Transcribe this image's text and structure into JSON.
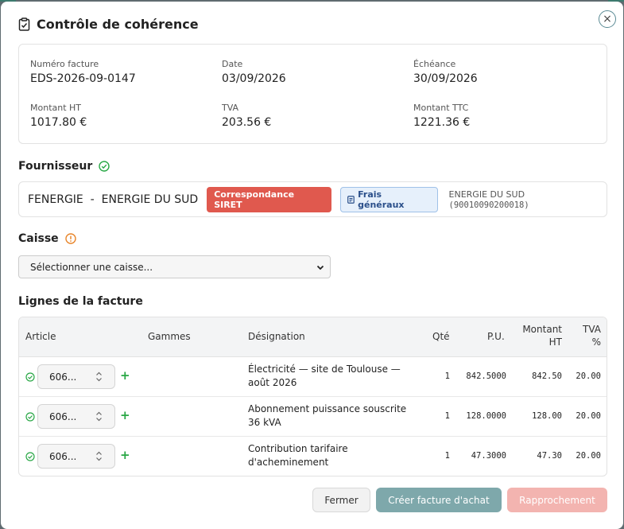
{
  "modal": {
    "title": "Contrôle de cohérence",
    "close_symbol": "×",
    "icons": {
      "title": "clipboard-check-icon",
      "close": "close-icon"
    }
  },
  "summary": {
    "invoice_number": {
      "label": "Numéro facture",
      "value": "EDS-2026-09-0147"
    },
    "date": {
      "label": "Date",
      "value": "03/09/2026"
    },
    "due": {
      "label": "Échéance",
      "value": "30/09/2026"
    },
    "amount_ht": {
      "label": "Montant HT",
      "value": "1017.80 €"
    },
    "tva": {
      "label": "TVA",
      "value": "203.56 €"
    },
    "amount_ttc": {
      "label": "Montant TTC",
      "value": "1221.36 €"
    }
  },
  "supplier": {
    "section_title": "Fournisseur",
    "status_icon": "check-circle-icon",
    "name": "FENERGIE  -  ENERGIE DU SUD",
    "match_badge": "Correspondance SIRET",
    "category_badge": "Frais généraux",
    "siret_name": "ENERGIE DU SUD",
    "siret_number": "(90010090200018)"
  },
  "caisse": {
    "section_title": "Caisse",
    "status_icon": "warning-circle-icon",
    "select_value": "Sélectionner une caisse..."
  },
  "lines": {
    "section_title": "Lignes de la facture",
    "headers": {
      "article": "Article",
      "gammes": "Gammes",
      "designation": "Désignation",
      "qty": "Qté",
      "pu": "P.U.",
      "montant_l1": "Montant",
      "montant_l2": "HT",
      "tva_l1": "TVA",
      "tva_l2": "%"
    },
    "rows": [
      {
        "article": "606...",
        "designation": "Électricité — site de Toulouse — août 2026",
        "qty": "1",
        "pu": "842.5000",
        "montant": "842.50",
        "tva": "20.00"
      },
      {
        "article": "606...",
        "designation": "Abonnement puissance souscrite 36 kVA",
        "qty": "1",
        "pu": "128.0000",
        "montant": "128.00",
        "tva": "20.00"
      },
      {
        "article": "606...",
        "designation": "Contribution tarifaire d'acheminement",
        "qty": "1",
        "pu": "47.3000",
        "montant": "47.30",
        "tva": "20.00"
      }
    ],
    "add_symbol": "+"
  },
  "footer": {
    "close": "Fermer",
    "create": "Créer facture d'achat",
    "match": "Rapprochement"
  },
  "colors": {
    "success": "#28a745",
    "warning": "#e8852a",
    "danger": "#e0594e",
    "primary": "#7ea8ab"
  }
}
